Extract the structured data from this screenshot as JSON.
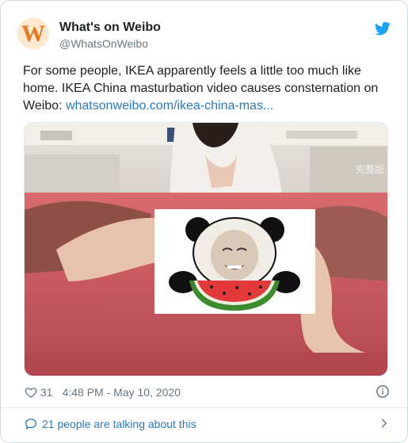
{
  "author": {
    "name": "What's on Weibo",
    "handle": "@WhatsOnWeibo",
    "avatar_letter": "W",
    "avatar_icon": "whatsonweibo-logo"
  },
  "tweet": {
    "text": "For some people, IKEA apparently feels a little too much like home. IKEA China masturbation video causes consternation on Weibo: ",
    "link_text": "whatsonweibo.com/ikea-china-mas..."
  },
  "media": {
    "watermark": "完整版",
    "censor_icon": "panda-meme-sticker"
  },
  "meta": {
    "likes": "31",
    "timestamp": "4:48 PM - May 10, 2020",
    "heart_icon": "heart-icon",
    "info_icon": "info-icon"
  },
  "footer": {
    "talk_text": "21 people are talking about this"
  },
  "colors": {
    "link": "#2b7bb9",
    "twitter_blue": "#1da1f2",
    "muted": "#697882",
    "avatar_orange": "#e8791f"
  }
}
